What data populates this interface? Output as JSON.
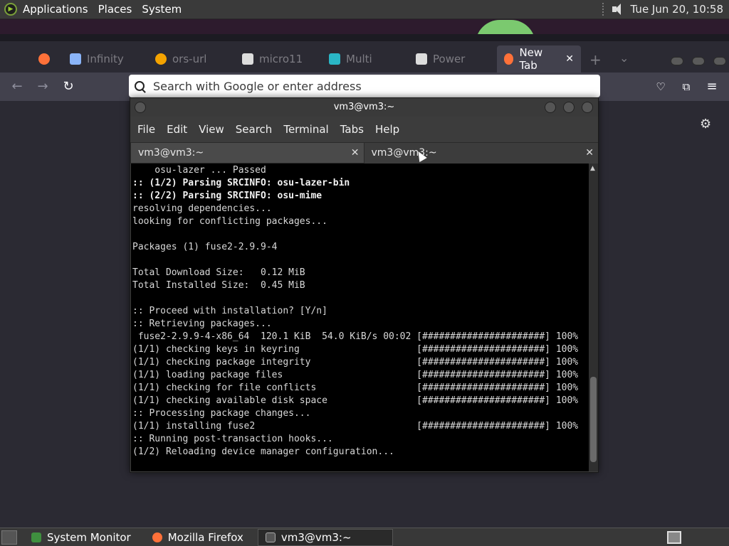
{
  "top_panel": {
    "menus": [
      "Applications",
      "Places",
      "System"
    ],
    "clock": "Tue Jun 20, 10:58"
  },
  "browser": {
    "tabs": [
      {
        "label": "Infinity",
        "icon": "settings-icon",
        "color": "#8ab4f8"
      },
      {
        "label": "ors-url",
        "icon": "globe-icon",
        "color": "#f4a300"
      },
      {
        "label": "micro11",
        "icon": "bank-icon",
        "color": "#dddddd"
      },
      {
        "label": "Multi",
        "icon": "puzzle-icon",
        "color": "#2ab6c6"
      },
      {
        "label": "Power",
        "icon": "grid-icon",
        "color": "#dddddd"
      },
      {
        "label": "New Tab",
        "icon": "firefox-icon",
        "color": "#ff7139"
      }
    ],
    "url_placeholder": "Search with Google or enter address"
  },
  "terminal": {
    "title": "vm3@vm3:~",
    "menu": [
      "File",
      "Edit",
      "View",
      "Search",
      "Terminal",
      "Tabs",
      "Help"
    ],
    "tabs": [
      "vm3@vm3:~",
      "vm3@vm3:~"
    ],
    "lines": [
      {
        "t": "    osu-lazer ... Passed",
        "b": false
      },
      {
        "t": ":: (1/2) Parsing SRCINFO: osu-lazer-bin",
        "b": true
      },
      {
        "t": ":: (2/2) Parsing SRCINFO: osu-mime",
        "b": true
      },
      {
        "t": "resolving dependencies...",
        "b": false
      },
      {
        "t": "looking for conflicting packages...",
        "b": false
      },
      {
        "t": "",
        "b": false
      },
      {
        "t": "Packages (1) fuse2-2.9.9-4",
        "b": false
      },
      {
        "t": "",
        "b": false
      },
      {
        "t": "Total Download Size:   0.12 MiB",
        "b": false
      },
      {
        "t": "Total Installed Size:  0.45 MiB",
        "b": false
      },
      {
        "t": "",
        "b": false
      },
      {
        "t": ":: Proceed with installation? [Y/n]",
        "b": false
      },
      {
        "t": ":: Retrieving packages...",
        "b": false
      },
      {
        "t": " fuse2-2.9.9-4-x86_64  120.1 KiB  54.0 KiB/s 00:02 [######################] 100%",
        "b": false
      },
      {
        "t": "(1/1) checking keys in keyring                     [######################] 100%",
        "b": false
      },
      {
        "t": "(1/1) checking package integrity                   [######################] 100%",
        "b": false
      },
      {
        "t": "(1/1) loading package files                        [######################] 100%",
        "b": false
      },
      {
        "t": "(1/1) checking for file conflicts                  [######################] 100%",
        "b": false
      },
      {
        "t": "(1/1) checking available disk space                [######################] 100%",
        "b": false
      },
      {
        "t": ":: Processing package changes...",
        "b": false
      },
      {
        "t": "(1/1) installing fuse2                             [######################] 100%",
        "b": false
      },
      {
        "t": ":: Running post-transaction hooks...",
        "b": false
      },
      {
        "t": "(1/2) Reloading device manager configuration...",
        "b": false
      }
    ]
  },
  "taskbar": {
    "items": [
      "System Monitor",
      "Mozilla Firefox",
      "vm3@vm3:~"
    ]
  }
}
